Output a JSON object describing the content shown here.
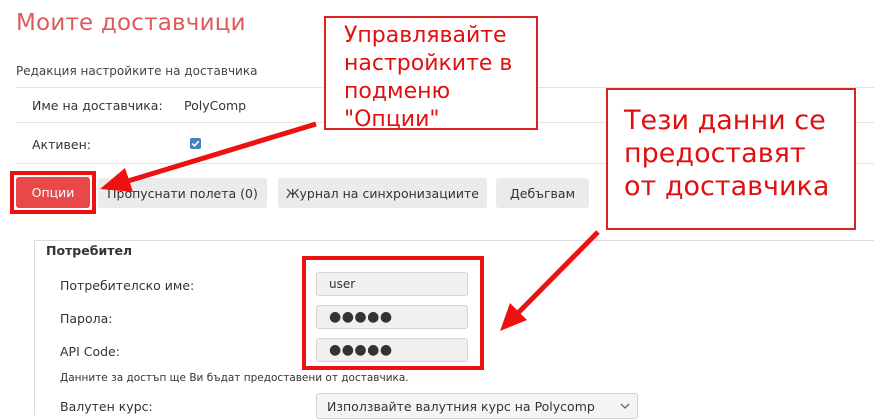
{
  "page": {
    "title": "Моите доставчици",
    "subtitle": "Редакция настройките на доставчика"
  },
  "supplier": {
    "name_label": "Име на доставчика:",
    "name_value": "PolyComp",
    "active_label": "Активен:",
    "active_checked": true
  },
  "toolbar": {
    "options": "Опции",
    "skipped_fields": "Пропуснати полета (0)",
    "sync_log": "Журнал на синхронизациите",
    "debug": "Дебъгвам"
  },
  "user_section": {
    "legend": "Потребител",
    "username_label": "Потребителско име:",
    "username_value": "user",
    "password_label": "Парола:",
    "password_value": "●●●●●",
    "apicode_label": "API Code:",
    "apicode_value": "●●●●●",
    "note": "Данните за достъп ще Ви бъдат предоставени от доставчика.",
    "currency_label": "Валутен курс:",
    "currency_value": "Използвайте валутния курс на Polycomp"
  },
  "callouts": {
    "options_hint": [
      "Управлявайте",
      "настройките в",
      "подменю",
      "\"Опции\""
    ],
    "data_hint": [
      "Тези данни се",
      "предоставят",
      "от доставчика"
    ]
  },
  "colors": {
    "accent": "#e05a5a",
    "primary_button": "#e84848",
    "annotation_red": "#ee1111",
    "checkbox": "#4a7fc1"
  }
}
